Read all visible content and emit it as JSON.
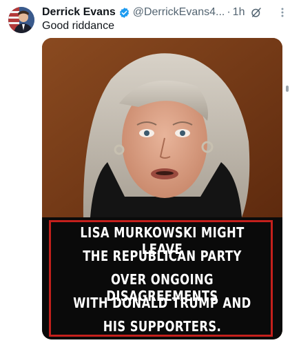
{
  "post": {
    "author_name": "Derrick Evans",
    "handle": "@DerrickEvans4...",
    "separator": "·",
    "time": "1h",
    "text": "Good riddance"
  },
  "media": {
    "caption_lines": [
      "LISA MURKOWSKI  MIGHT LEAVE",
      "THE REPUBLICAN PARTY",
      "OVER ONGOING DISAGREEMENTS",
      "WITH DONALD TRUMP AND",
      "HIS SUPPORTERS."
    ]
  },
  "icons": {
    "verified": "verified-badge-icon",
    "grok": "grok-icon",
    "more": "more-options-icon"
  },
  "colors": {
    "verified_blue": "#1d9bf0",
    "caption_border": "#c4201c",
    "caption_bg": "#0a0a0a",
    "muted_text": "#536471"
  }
}
